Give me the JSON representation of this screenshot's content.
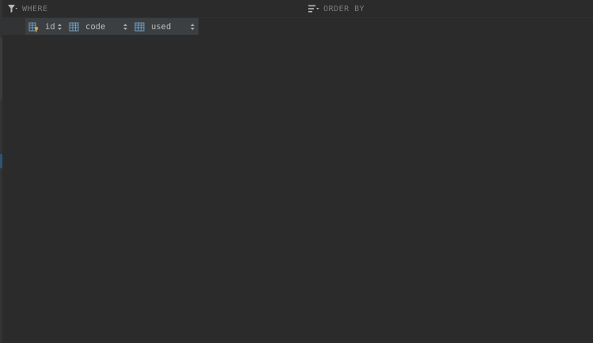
{
  "filter": {
    "where_placeholder": "WHERE",
    "orderby_placeholder": "ORDER BY"
  },
  "columns": [
    {
      "name": "id",
      "icon": "primary-key-column-icon"
    },
    {
      "name": "code",
      "icon": "column-icon"
    },
    {
      "name": "used",
      "icon": "column-icon"
    }
  ],
  "colors": {
    "background": "#2b2b2b",
    "header": "#3c3f41",
    "text": "#bbbbbb",
    "placeholder": "#7a7d80",
    "key_accent": "#d9a343",
    "column_icon": "#6e9dc4"
  }
}
